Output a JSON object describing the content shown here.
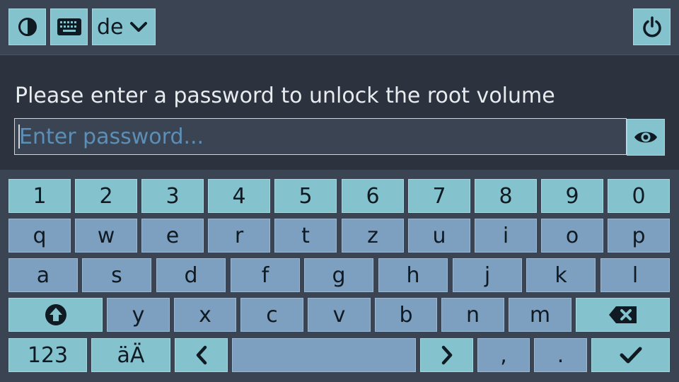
{
  "topbar": {
    "contrast_icon": "contrast-icon",
    "keyboard_icon": "keyboard-icon",
    "language_value": "de",
    "power_icon": "power-icon"
  },
  "unlock": {
    "prompt": "Please enter a password to unlock the root volume",
    "placeholder": "Enter password...",
    "value": "",
    "show_password_icon": "eye-icon"
  },
  "keyboard": {
    "row1": [
      "1",
      "2",
      "3",
      "4",
      "5",
      "6",
      "7",
      "8",
      "9",
      "0"
    ],
    "row2": [
      "q",
      "w",
      "e",
      "r",
      "t",
      "z",
      "u",
      "i",
      "o",
      "p"
    ],
    "row3": [
      "a",
      "s",
      "d",
      "f",
      "g",
      "h",
      "j",
      "k",
      "l"
    ],
    "row4": [
      "y",
      "x",
      "c",
      "v",
      "b",
      "n",
      "m"
    ],
    "row5": {
      "numbers_label": "123",
      "umlaut_label": "äÄ",
      "left_icon": "chevron-left-icon",
      "space_label": "",
      "right_icon": "chevron-right-icon",
      "comma": ",",
      "period": ".",
      "enter_icon": "checkmark-icon"
    },
    "shift_icon": "shift-icon",
    "backspace_icon": "backspace-icon"
  },
  "colors": {
    "background": "#3b4452",
    "panel": "#2c333f",
    "digit_key": "#84c2ce",
    "letter_key": "#7d9fc0",
    "placeholder": "#5c8fb8"
  }
}
